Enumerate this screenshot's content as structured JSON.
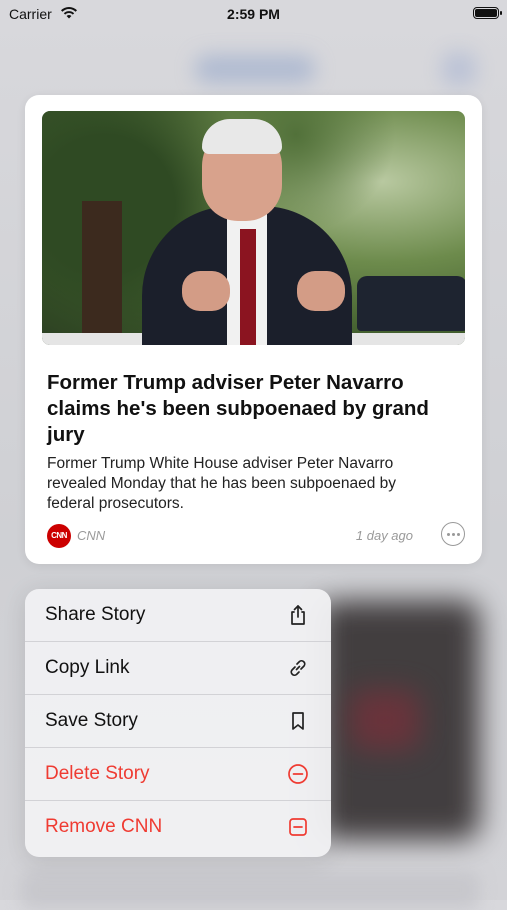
{
  "status_bar": {
    "carrier": "Carrier",
    "time": "2:59 PM"
  },
  "article": {
    "headline": "Former Trump adviser Peter Navarro claims he's been subpoenaed by grand jury",
    "summary": "Former Trump White House adviser Peter Navarro revealed Monday that he has been subpoenaed by federal prosecutors.",
    "source": "CNN",
    "source_logo_text": "CNN",
    "time_ago": "1 day ago",
    "image_icon": "news-photo"
  },
  "menu": {
    "items": [
      {
        "label": "Share Story",
        "icon": "share-icon",
        "danger": false
      },
      {
        "label": "Copy Link",
        "icon": "link-icon",
        "danger": false
      },
      {
        "label": "Save Story",
        "icon": "bookmark-icon",
        "danger": false
      },
      {
        "label": "Delete Story",
        "icon": "minus-circle-icon",
        "danger": true
      },
      {
        "label": "Remove CNN",
        "icon": "minus-square-icon",
        "danger": true
      }
    ]
  },
  "colors": {
    "danger": "#ef3b32",
    "brand_cnn": "#cc0000"
  }
}
